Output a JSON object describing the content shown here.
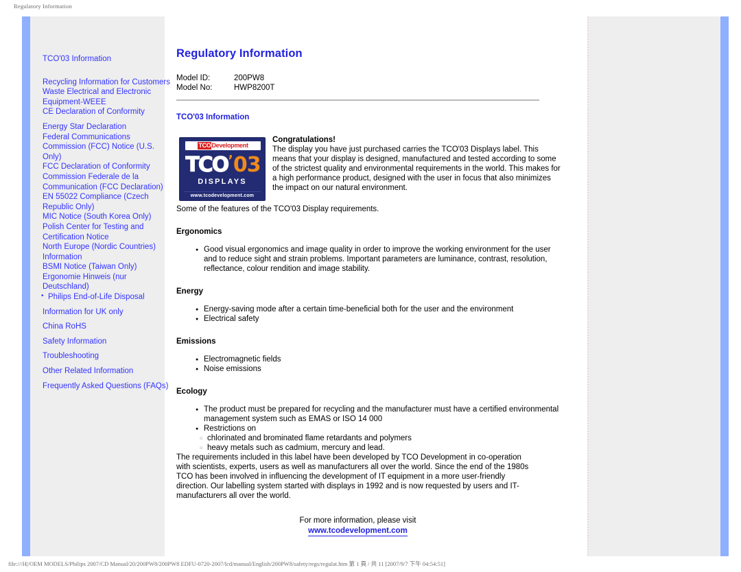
{
  "print": {
    "header_title": "Regulatory Information",
    "footer_path": "file:///H|/OEM MODELS/Philips 2007/CD Manual/20/200PW8/200PW8 EDFU-0720-2007/lcd/manual/English/200PW8/safety/regs/regulat.htm 第 1 頁 / 共 11 [2007/9/7 下午 04:54:51]"
  },
  "colors": {
    "link_blue": "#3333ff",
    "heading_blue": "#2222dd",
    "accent_bar": "#8fafff",
    "panel_gray": "#eeeeee",
    "tco_navy": "#232c72",
    "tco_red": "#d8201f",
    "tco_orange": "#f08a1c"
  },
  "sidebar": {
    "items": [
      {
        "label": "TCO'03 Information",
        "bulleted": false,
        "spacing": "first"
      },
      {
        "label": "Recycling Information for Customers",
        "bulleted": false,
        "spacing": "gap"
      },
      {
        "label": "Waste Electrical and Electronic Equipment-WEEE",
        "bulleted": false,
        "spacing": "none"
      },
      {
        "label": "CE Declaration of Conformity",
        "bulleted": false,
        "spacing": "none"
      },
      {
        "label": "Energy Star Declaration",
        "bulleted": false,
        "spacing": "small"
      },
      {
        "label": "Federal Communications Commission (FCC) Notice (U.S. Only)",
        "bulleted": false,
        "spacing": "none"
      },
      {
        "label": "FCC Declaration of Conformity",
        "bulleted": false,
        "spacing": "none"
      },
      {
        "label": "Commission Federale de la Communication (FCC Declaration)",
        "bulleted": false,
        "spacing": "none"
      },
      {
        "label": "EN 55022 Compliance (Czech Republic Only)",
        "bulleted": false,
        "spacing": "none"
      },
      {
        "label": "MIC Notice (South Korea Only)",
        "bulleted": false,
        "spacing": "none"
      },
      {
        "label": "Polish Center for Testing and Certification Notice",
        "bulleted": false,
        "spacing": "none"
      },
      {
        "label": "North Europe (Nordic Countries) Information",
        "bulleted": false,
        "spacing": "none"
      },
      {
        "label": "BSMI Notice (Taiwan Only)",
        "bulleted": false,
        "spacing": "none"
      },
      {
        "label": "Ergonomie Hinweis (nur Deutschland)",
        "bulleted": false,
        "spacing": "none"
      },
      {
        "label": "Philips End-of-Life Disposal",
        "bulleted": true,
        "spacing": "none"
      },
      {
        "label": "Information for UK only",
        "bulleted": false,
        "spacing": "small"
      },
      {
        "label": "China RoHS",
        "bulleted": false,
        "spacing": "small"
      },
      {
        "label": "Safety Information",
        "bulleted": false,
        "spacing": "small"
      },
      {
        "label": "Troubleshooting",
        "bulleted": false,
        "spacing": "small"
      },
      {
        "label": "Other Related Information",
        "bulleted": false,
        "spacing": "small"
      },
      {
        "label": "Frequently Asked Questions (FAQs)",
        "bulleted": false,
        "spacing": "small"
      }
    ]
  },
  "main": {
    "title": "Regulatory Information",
    "model": {
      "id_label": "Model ID:",
      "id_value": "200PW8",
      "no_label": "Model No:",
      "no_value": "HWP8200T"
    },
    "section_title": "TCO'03 Information",
    "tco_logo": {
      "banner_mark": "TCO",
      "banner_word": "Development",
      "main_word": "TCO",
      "main_tick": "’",
      "main_number": "03",
      "displays": "DISPLAYS",
      "url": "www.tcodevelopment.com"
    },
    "congratulations_heading": "Congratulations!",
    "congratulations_body": "The display you have just purchased carries the TCO'03 Displays label. This means that your display is designed, manufactured and tested according to some of the strictest quality and environmental requirements in the world. This makes for a high performance product, designed with the user in focus that also minimizes the impact on our natural environment.",
    "features_intro": "Some of the features of the TCO'03 Display requirements.",
    "ergonomics": {
      "heading": "Ergonomics",
      "items": [
        "Good visual ergonomics and image quality in order to improve the working environment for the user and to reduce sight and strain problems. Important parameters are luminance, contrast, resolution, reflectance, colour rendition and image stability."
      ]
    },
    "energy": {
      "heading": "Energy",
      "items": [
        "Energy-saving mode after a certain time-beneficial both for the user and the environment",
        "Electrical safety"
      ]
    },
    "emissions": {
      "heading": "Emissions",
      "items": [
        "Electromagnetic fields",
        "Noise emissions"
      ]
    },
    "ecology": {
      "heading": "Ecology",
      "items": [
        "The product must be prepared for recycling and the manufacturer must have a certified environmental management system such as EMAS or ISO 14 000",
        "Restrictions on"
      ],
      "sub_items": [
        "chlorinated and brominated flame retardants and polymers",
        "heavy metals such as cadmium, mercury and lead."
      ]
    },
    "closing_paragraph": "The requirements included in this label have been developed by TCO Development in co-operation with scientists, experts, users as well as manufacturers all over the world. Since the end of the 1980s TCO has been involved in influencing the development of IT equipment in a more user-friendly direction. Our labelling system started with displays in 1992 and is now requested by users and IT-manufacturers all over the world.",
    "more_info_text": "For more information, please visit",
    "more_info_link": "www.tcodevelopment.com"
  }
}
